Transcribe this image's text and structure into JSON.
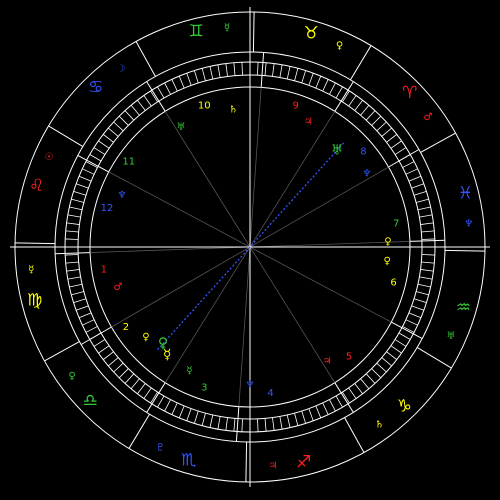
{
  "colors": {
    "background": "#000000",
    "line": "#ffffff",
    "green": "#33cc33",
    "yellow": "#ffff00",
    "red": "#ff2020",
    "blue": "#3355ff"
  },
  "zodiac_signs": [
    {
      "glyph": "♊",
      "name": "gemini-sign",
      "color": "#33cc33",
      "angle": 104
    },
    {
      "glyph": "♉",
      "name": "taurus-sign",
      "color": "#ffff00",
      "angle": 74
    },
    {
      "glyph": "♈",
      "name": "aries-sign",
      "color": "#ff2020",
      "angle": 44
    },
    {
      "glyph": "♓",
      "name": "pisces-sign",
      "color": "#3355ff",
      "angle": 14
    },
    {
      "glyph": "♒",
      "name": "aquarius-sign",
      "color": "#33cc33",
      "angle": -16
    },
    {
      "glyph": "♑",
      "name": "capricorn-sign",
      "color": "#ffff00",
      "angle": -46
    },
    {
      "glyph": "♐",
      "name": "sagittarius-sign",
      "color": "#ff2020",
      "angle": -76
    },
    {
      "glyph": "♏",
      "name": "scorpio-sign",
      "color": "#3355ff",
      "angle": -106
    },
    {
      "glyph": "♎",
      "name": "libra-sign",
      "color": "#33cc33",
      "angle": -136
    },
    {
      "glyph": "♍",
      "name": "virgo-sign",
      "color": "#ffff00",
      "angle": -166
    },
    {
      "glyph": "♌",
      "name": "leo-sign",
      "color": "#ff2020",
      "angle": 164
    },
    {
      "glyph": "♋",
      "name": "cancer-sign",
      "color": "#3355ff",
      "angle": 134
    }
  ],
  "sign_rulers": [
    {
      "glyph": "☿",
      "color": "#33cc33",
      "angle": 96
    },
    {
      "glyph": "♀",
      "color": "#ffff00",
      "angle": 66
    },
    {
      "glyph": "♂",
      "color": "#ff2020",
      "angle": 36
    },
    {
      "glyph": "♆",
      "color": "#3355ff",
      "angle": 6
    },
    {
      "glyph": "♅",
      "color": "#33cc33",
      "angle": -24
    },
    {
      "glyph": "♄",
      "color": "#ffff00",
      "angle": -54
    },
    {
      "glyph": "♃",
      "color": "#ff2020",
      "angle": -84
    },
    {
      "glyph": "♇",
      "color": "#3355ff",
      "angle": -114
    },
    {
      "glyph": "♀",
      "color": "#33cc33",
      "angle": -144
    },
    {
      "glyph": "☿",
      "color": "#ffff00",
      "angle": -174
    },
    {
      "glyph": "☉",
      "color": "#ff2020",
      "angle": 156
    },
    {
      "glyph": "☽",
      "color": "#3355ff",
      "angle": 126
    }
  ],
  "houses": [
    {
      "number": "1",
      "color": "#ff2020",
      "angle": -171
    },
    {
      "number": "2",
      "color": "#ffff00",
      "angle": -147
    },
    {
      "number": "3",
      "color": "#33cc33",
      "angle": -108
    },
    {
      "number": "4",
      "color": "#3355ff",
      "angle": -82
    },
    {
      "number": "5",
      "color": "#ff2020",
      "angle": -48
    },
    {
      "number": "6",
      "color": "#ffff00",
      "angle": -14
    },
    {
      "number": "7",
      "color": "#33cc33",
      "angle": 9
    },
    {
      "number": "8",
      "color": "#3355ff",
      "angle": 40
    },
    {
      "number": "9",
      "color": "#ff2020",
      "angle": 72
    },
    {
      "number": "10",
      "color": "#ffff00",
      "angle": 108
    },
    {
      "number": "11",
      "color": "#33cc33",
      "angle": 145
    },
    {
      "number": "12",
      "color": "#3355ff",
      "angle": 165
    }
  ],
  "house_rulers": [
    {
      "glyph": "♂",
      "color": "#ff2020",
      "angle": -163
    },
    {
      "glyph": "♀",
      "color": "#ffff00",
      "angle": -139
    },
    {
      "glyph": "☿",
      "color": "#33cc33",
      "angle": -116
    },
    {
      "glyph": "♆",
      "color": "#3355ff",
      "angle": -90
    },
    {
      "glyph": "♃",
      "color": "#ff2020",
      "angle": -56
    },
    {
      "glyph": "♀",
      "color": "#ffff00",
      "angle": -6
    },
    {
      "glyph": "♀",
      "color": "#ffff00",
      "angle": 2
    },
    {
      "glyph": "♆",
      "color": "#3355ff",
      "angle": 32
    },
    {
      "glyph": "♃",
      "color": "#ff2020",
      "angle": 65
    },
    {
      "glyph": "♄",
      "color": "#ffff00",
      "angle": 97
    },
    {
      "glyph": "♅",
      "color": "#33cc33",
      "angle": 120
    },
    {
      "glyph": "♆",
      "color": "#3355ff",
      "angle": 158
    }
  ],
  "planets": [
    {
      "glyph": "♅",
      "color": "#33cc33",
      "angle": 48
    },
    {
      "glyph": "♀",
      "color": "#33cc33",
      "angle": -132
    },
    {
      "glyph": "☿",
      "color": "#ffff00",
      "angle": -132
    }
  ],
  "house_cusps": [
    2,
    30,
    58,
    86,
    122,
    152,
    182,
    210,
    238,
    266,
    302,
    332
  ],
  "aspects": [
    {
      "from_angle": 48,
      "to_angle": -132,
      "color": "#3355ff",
      "style": "dotted"
    }
  ],
  "cardinal_axes": [
    0,
    90
  ]
}
